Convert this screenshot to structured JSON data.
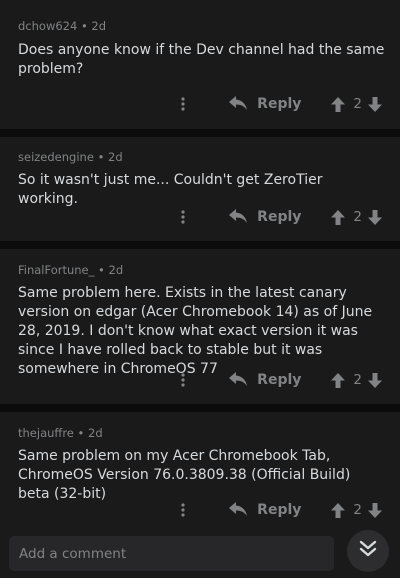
{
  "comments": [
    {
      "author": "dchow624",
      "age": "2d",
      "body": "Does anyone know if the Dev channel had the same problem?",
      "reply_label": "Reply",
      "score": "2"
    },
    {
      "author": "seizedengine",
      "age": "2d",
      "body": "So it wasn't just me... Couldn't get ZeroTier working.",
      "reply_label": "Reply",
      "score": "2"
    },
    {
      "author": "FinalFortune_",
      "age": "2d",
      "body": "Same problem here. Exists in the latest canary version on edgar (Acer Chromebook 14) as of June 28, 2019. I don't know what exact version it was since I have rolled back to stable but it was somewhere in ChromeOS 77",
      "reply_label": "Reply",
      "score": "2"
    },
    {
      "author": "thejauffre",
      "age": "2d",
      "body": "Same problem on my Acer Chromebook Tab, ChromeOS Version 76.0.3809.38 (Official Build) beta (32-bit)",
      "reply_label": "Reply",
      "score": "2"
    }
  ],
  "separator": "•",
  "composer": {
    "placeholder": "Add a comment"
  },
  "icons": {
    "more": "more-vertical-icon",
    "reply": "reply-arrow-icon",
    "upvote": "upvote-arrow-icon",
    "downvote": "downvote-arrow-icon",
    "jump": "double-chevron-down-icon"
  },
  "colors": {
    "page_bg": "#0b0b0b",
    "card_bg": "#1a1a1b",
    "text": "#d7dadc",
    "muted": "#818384",
    "input_bg": "#272729"
  }
}
